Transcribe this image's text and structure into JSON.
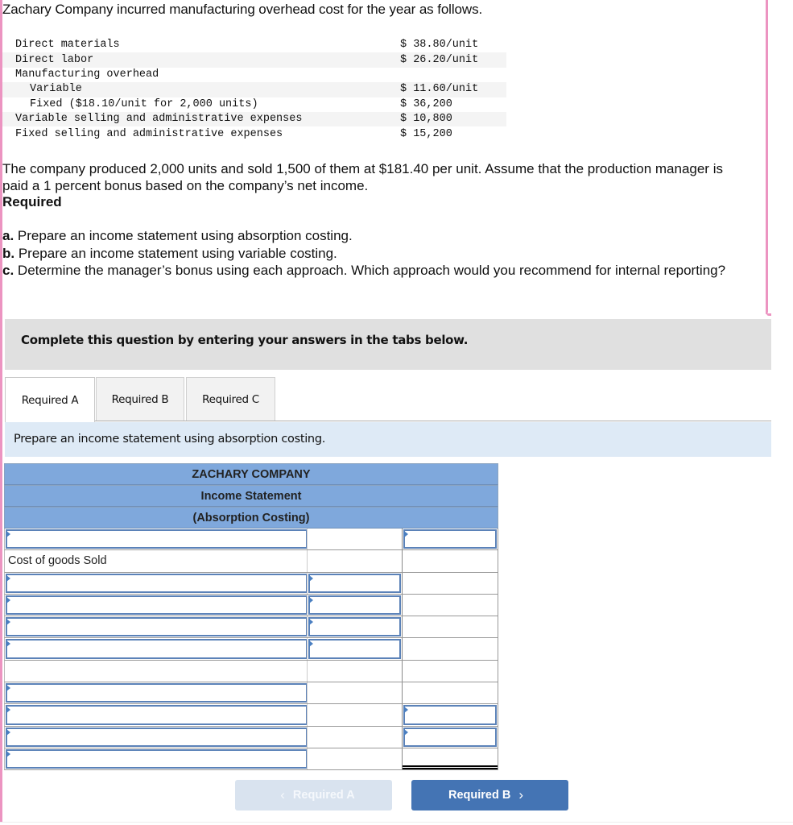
{
  "question": {
    "intro": "Zachary Company incurred manufacturing overhead cost for the year as follows.",
    "cost_items": [
      {
        "label": "Direct materials",
        "value": "$ 38.80/unit",
        "indent": false,
        "shaded": false
      },
      {
        "label": "Direct labor",
        "value": "$ 26.20/unit",
        "indent": false,
        "shaded": true
      },
      {
        "label": "Manufacturing overhead",
        "value": "",
        "indent": false,
        "shaded": false
      },
      {
        "label": "Variable",
        "value": "$ 11.60/unit",
        "indent": true,
        "shaded": true
      },
      {
        "label": "Fixed ($18.10/unit for 2,000 units)",
        "value": "$ 36,200",
        "indent": true,
        "shaded": false
      },
      {
        "label": "Variable selling and administrative expenses",
        "value": "$ 10,800",
        "indent": false,
        "shaded": true
      },
      {
        "label": "Fixed selling and administrative expenses",
        "value": "$ 15,200",
        "indent": false,
        "shaded": false
      }
    ],
    "paragraph": "The company produced 2,000 units and sold 1,500 of them at $181.40 per unit. Assume that the production manager is paid a 1 percent bonus based on the company’s net income.",
    "required_heading": "Required",
    "requirements": [
      {
        "letter": "a.",
        "text": "Prepare an income statement using absorption costing."
      },
      {
        "letter": "b.",
        "text": "Prepare an income statement using variable costing."
      },
      {
        "letter": "c.",
        "text": "Determine the manager’s bonus using each approach. Which approach would you recommend for internal reporting?"
      }
    ]
  },
  "instructions_bar": "Complete this question by entering your answers in the tabs below.",
  "tabs": [
    {
      "label": "Required A",
      "active": true
    },
    {
      "label": "Required B",
      "active": false
    },
    {
      "label": "Required C",
      "active": false
    }
  ],
  "tab_instruction": "Prepare an income statement using absorption costing.",
  "statement": {
    "company": "ZACHARY COMPANY",
    "title": "Income Statement",
    "subtitle": "(Absorption Costing)",
    "rows": [
      {
        "label": "",
        "c1": "input",
        "c2": "none",
        "c3": "input"
      },
      {
        "label": "Cost of goods Sold",
        "c1": "text",
        "c2": "none",
        "c3": "none"
      },
      {
        "label": "",
        "c1": "input",
        "c2": "input",
        "c3": "none"
      },
      {
        "label": "",
        "c1": "input",
        "c2": "input",
        "c3": "none"
      },
      {
        "label": "",
        "c1": "input",
        "c2": "input",
        "c3": "none"
      },
      {
        "label": "",
        "c1": "input",
        "c2": "input",
        "c3": "none"
      },
      {
        "label": "",
        "c1": "none",
        "c2": "none",
        "c3": "none"
      },
      {
        "label": "",
        "c1": "input",
        "c2": "none",
        "c3": "none"
      },
      {
        "label": "",
        "c1": "input",
        "c2": "none",
        "c3": "input"
      },
      {
        "label": "",
        "c1": "input",
        "c2": "none",
        "c3": "input"
      },
      {
        "label": "",
        "c1": "input",
        "c2": "none",
        "c3": "total"
      }
    ]
  },
  "navigation": {
    "prev_label": "Required A",
    "next_label": "Required B",
    "prev_enabled": false,
    "next_enabled": true
  },
  "colors": {
    "frame_pink": "#ec94c1",
    "header_blue": "#7fa8dc",
    "input_border": "#5b82b8",
    "next_button": "#4474b4",
    "prev_button_disabled": "#d9e3ef",
    "instruction_bg": "#deeaf6",
    "complete_bar_bg": "#e0e0e0"
  }
}
